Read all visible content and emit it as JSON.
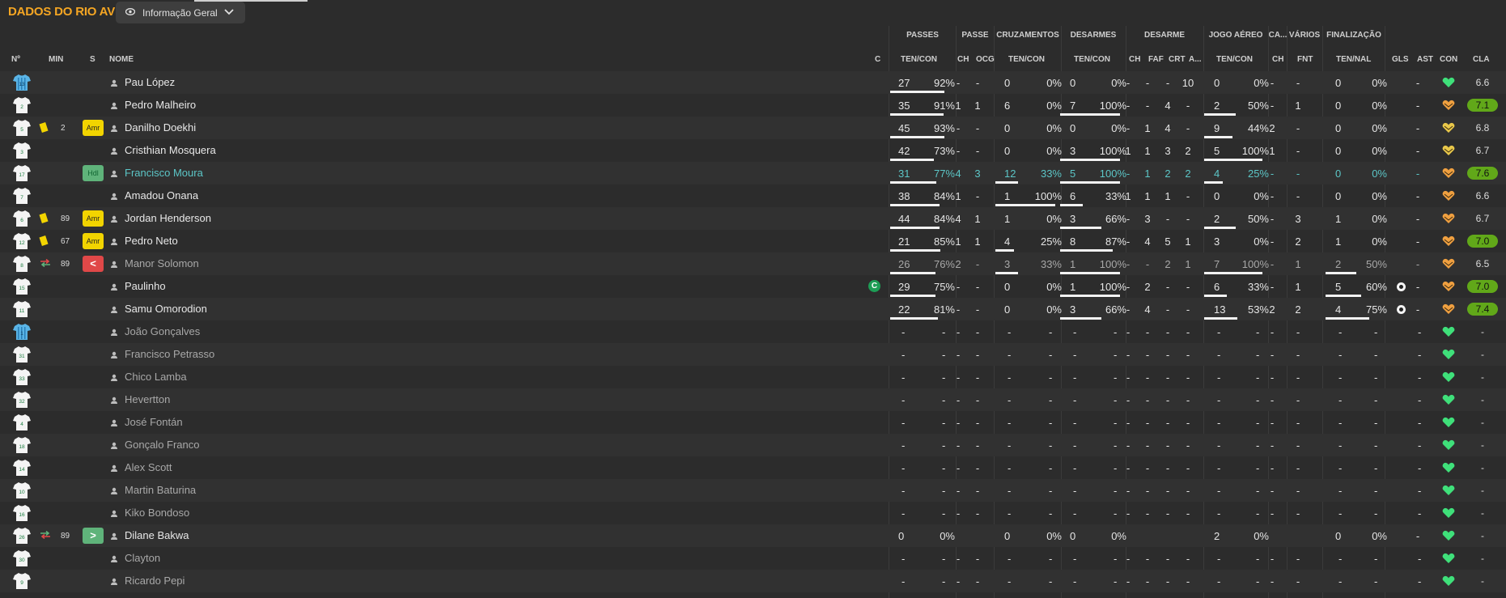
{
  "header": {
    "title": "DADOS DO RIO AVE",
    "view_dropdown": "Informação Geral"
  },
  "group_headers": {
    "passes": "PASSES",
    "passe": "PASSE",
    "cruzamentos": "CRUZAMENTOS",
    "desarmes": "DESARMES",
    "desarme": "DESARME",
    "jogo_aereo": "JOGO AÉREO",
    "ca": "CA...",
    "varios": "VÁRIOS",
    "finalizacao": "FINALIZAÇÃO"
  },
  "columns": {
    "num": "Nº",
    "min": "MIN",
    "s": "S",
    "nome": "NOME",
    "c": "C",
    "passes": "TEN/CON",
    "passe_ch": "CH",
    "passe_ocg": "OCG",
    "cruz": "TEN/CON",
    "desarmes": "TEN/CON",
    "des_ch": "CH",
    "des_faf": "FAF",
    "des_crt": "CRT",
    "des_a": "A...",
    "aereo": "TEN/CON",
    "ca_ch": "CH",
    "fnt": "FNT",
    "final": "TEN/NAL",
    "gls": "GLS",
    "ast": "AST",
    "con": "CON",
    "cla": "CLA"
  },
  "colors": {
    "accent": "#f5a623",
    "heart_green": "#3fe07a",
    "heart_orange": "#f0a040",
    "rating_green": "#61a819"
  },
  "players": [
    {
      "num": "13",
      "gk": true,
      "name": "Pau López",
      "minutes": "",
      "card": false,
      "badge": "",
      "swap": "",
      "dim": false,
      "teal": false,
      "captain": false,
      "pt": "27",
      "pp": "92%",
      "pp_v": 0.92,
      "pch": "-",
      "ocg": "-",
      "cr": "0",
      "crp": "0%",
      "cr_v": 0,
      "ds": "0",
      "dsp": "0%",
      "ds_v": 0,
      "dch": "-",
      "faf": "-",
      "crt": "-",
      "da": "10",
      "ae": "0",
      "aep": "0%",
      "ae_v": 0,
      "cach": "-",
      "fnt": "-",
      "fi": "0",
      "fip": "0%",
      "fi_v": 0,
      "gls": "",
      "ast": "-",
      "heart": "green",
      "cla": "6.6",
      "cla_hl": false
    },
    {
      "num": "2",
      "gk": false,
      "name": "Pedro Malheiro",
      "minutes": "",
      "card": false,
      "badge": "",
      "swap": "",
      "dim": false,
      "teal": false,
      "captain": false,
      "pt": "35",
      "pp": "91%",
      "pp_v": 0.91,
      "pch": "1",
      "ocg": "1",
      "cr": "6",
      "crp": "0%",
      "cr_v": 0,
      "ds": "7",
      "dsp": "100%",
      "ds_v": 1,
      "dch": "-",
      "faf": "-",
      "crt": "4",
      "da": "-",
      "ae": "2",
      "aep": "50%",
      "ae_v": 0.5,
      "cach": "-",
      "fnt": "1",
      "fi": "0",
      "fip": "0%",
      "fi_v": 0,
      "gls": "",
      "ast": "-",
      "heart": "orange",
      "cla": "7.1",
      "cla_hl": true
    },
    {
      "num": "5",
      "gk": false,
      "name": "Danilho Doekhi",
      "minutes": "2",
      "card": true,
      "badge": "Amr",
      "swap": "",
      "dim": false,
      "teal": false,
      "captain": false,
      "pt": "45",
      "pp": "93%",
      "pp_v": 0.93,
      "pch": "-",
      "ocg": "-",
      "cr": "0",
      "crp": "0%",
      "cr_v": 0,
      "ds": "0",
      "dsp": "0%",
      "ds_v": 0,
      "dch": "-",
      "faf": "1",
      "crt": "4",
      "da": "-",
      "ae": "9",
      "aep": "44%",
      "ae_v": 0.44,
      "cach": "2",
      "fnt": "-",
      "fi": "0",
      "fip": "0%",
      "fi_v": 0,
      "gls": "",
      "ast": "-",
      "heart": "yellow",
      "cla": "6.8",
      "cla_hl": false
    },
    {
      "num": "3",
      "gk": false,
      "name": "Cristhian Mosquera",
      "minutes": "",
      "card": false,
      "badge": "",
      "swap": "",
      "dim": false,
      "teal": false,
      "captain": false,
      "pt": "42",
      "pp": "73%",
      "pp_v": 0.73,
      "pch": "-",
      "ocg": "-",
      "cr": "0",
      "crp": "0%",
      "cr_v": 0,
      "ds": "3",
      "dsp": "100%",
      "ds_v": 1,
      "dch": "1",
      "faf": "1",
      "crt": "3",
      "da": "2",
      "ae": "5",
      "aep": "100%",
      "ae_v": 1,
      "cach": "1",
      "fnt": "-",
      "fi": "0",
      "fip": "0%",
      "fi_v": 0,
      "gls": "",
      "ast": "-",
      "heart": "yellow",
      "cla": "6.7",
      "cla_hl": false
    },
    {
      "num": "17",
      "gk": false,
      "name": "Francisco Moura",
      "minutes": "",
      "card": false,
      "badge": "Hdl",
      "swap": "",
      "dim": false,
      "teal": true,
      "captain": false,
      "pt": "31",
      "pp": "77%",
      "pp_v": 0.77,
      "pch": "4",
      "ocg": "3",
      "cr": "12",
      "crp": "33%",
      "cr_v": 0.33,
      "ds": "5",
      "dsp": "100%",
      "ds_v": 1,
      "dch": "-",
      "faf": "1",
      "crt": "2",
      "da": "2",
      "ae": "4",
      "aep": "25%",
      "ae_v": 0.25,
      "cach": "-",
      "fnt": "-",
      "fi": "0",
      "fip": "0%",
      "fi_v": 0,
      "gls": "",
      "ast": "-",
      "heart": "orange",
      "cla": "7.6",
      "cla_hl": true
    },
    {
      "num": "7",
      "gk": false,
      "name": "Amadou Onana",
      "minutes": "",
      "card": false,
      "badge": "",
      "swap": "",
      "dim": false,
      "teal": false,
      "captain": false,
      "pt": "38",
      "pp": "84%",
      "pp_v": 0.84,
      "pch": "1",
      "ocg": "-",
      "cr": "1",
      "crp": "100%",
      "cr_v": 1,
      "ds": "6",
      "dsp": "33%",
      "ds_v": 0.33,
      "dch": "1",
      "faf": "1",
      "crt": "1",
      "da": "-",
      "ae": "0",
      "aep": "0%",
      "ae_v": 0,
      "cach": "-",
      "fnt": "-",
      "fi": "0",
      "fip": "0%",
      "fi_v": 0,
      "gls": "",
      "ast": "-",
      "heart": "orange",
      "cla": "6.6",
      "cla_hl": false
    },
    {
      "num": "6",
      "gk": false,
      "name": "Jordan Henderson",
      "minutes": "89",
      "card": true,
      "badge": "Amr",
      "swap": "",
      "dim": false,
      "teal": false,
      "captain": false,
      "pt": "44",
      "pp": "84%",
      "pp_v": 0.84,
      "pch": "4",
      "ocg": "1",
      "cr": "1",
      "crp": "0%",
      "cr_v": 0,
      "ds": "3",
      "dsp": "66%",
      "ds_v": 0.66,
      "dch": "-",
      "faf": "3",
      "crt": "-",
      "da": "-",
      "ae": "2",
      "aep": "50%",
      "ae_v": 0.5,
      "cach": "-",
      "fnt": "3",
      "fi": "1",
      "fip": "0%",
      "fi_v": 0,
      "gls": "",
      "ast": "-",
      "heart": "orange",
      "cla": "6.7",
      "cla_hl": false
    },
    {
      "num": "12",
      "gk": false,
      "name": "Pedro Neto",
      "minutes": "67",
      "card": true,
      "badge": "Amr",
      "swap": "",
      "dim": false,
      "teal": false,
      "captain": false,
      "pt": "21",
      "pp": "85%",
      "pp_v": 0.85,
      "pch": "1",
      "ocg": "1",
      "cr": "4",
      "crp": "25%",
      "cr_v": 0.25,
      "ds": "8",
      "dsp": "87%",
      "ds_v": 0.87,
      "dch": "-",
      "faf": "4",
      "crt": "5",
      "da": "1",
      "ae": "3",
      "aep": "0%",
      "ae_v": 0,
      "cach": "-",
      "fnt": "2",
      "fi": "1",
      "fip": "0%",
      "fi_v": 0,
      "gls": "",
      "ast": "-",
      "heart": "orange",
      "cla": "7.0",
      "cla_hl": true
    },
    {
      "num": "8",
      "gk": false,
      "name": "Manor Solomon",
      "minutes": "89",
      "card": false,
      "badge": "<",
      "swap": "out",
      "dim": true,
      "teal": false,
      "captain": false,
      "pt": "26",
      "pp": "76%",
      "pp_v": 0.76,
      "pch": "2",
      "ocg": "-",
      "cr": "3",
      "crp": "33%",
      "cr_v": 0.33,
      "ds": "1",
      "dsp": "100%",
      "ds_v": 1,
      "dch": "-",
      "faf": "-",
      "crt": "2",
      "da": "1",
      "ae": "7",
      "aep": "100%",
      "ae_v": 1,
      "cach": "-",
      "fnt": "1",
      "fi": "2",
      "fip": "50%",
      "fi_v": 0.5,
      "gls": "",
      "ast": "-",
      "heart": "orange",
      "cla": "6.5",
      "cla_hl": false
    },
    {
      "num": "15",
      "gk": false,
      "name": "Paulinho",
      "minutes": "",
      "card": false,
      "badge": "",
      "swap": "",
      "dim": false,
      "teal": false,
      "captain": true,
      "pt": "29",
      "pp": "75%",
      "pp_v": 0.75,
      "pch": "-",
      "ocg": "-",
      "cr": "0",
      "crp": "0%",
      "cr_v": 0,
      "ds": "1",
      "dsp": "100%",
      "ds_v": 1,
      "dch": "-",
      "faf": "2",
      "crt": "-",
      "da": "-",
      "ae": "6",
      "aep": "33%",
      "ae_v": 0.33,
      "cach": "-",
      "fnt": "1",
      "fi": "5",
      "fip": "60%",
      "fi_v": 0.6,
      "gls": "ball",
      "ast": "-",
      "heart": "orange",
      "cla": "7.0",
      "cla_hl": true
    },
    {
      "num": "11",
      "gk": false,
      "name": "Samu Omorodion",
      "minutes": "",
      "card": false,
      "badge": "",
      "swap": "",
      "dim": false,
      "teal": false,
      "captain": false,
      "pt": "22",
      "pp": "81%",
      "pp_v": 0.81,
      "pch": "-",
      "ocg": "-",
      "cr": "0",
      "crp": "0%",
      "cr_v": 0,
      "ds": "3",
      "dsp": "66%",
      "ds_v": 0.66,
      "dch": "-",
      "faf": "4",
      "crt": "-",
      "da": "-",
      "ae": "13",
      "aep": "53%",
      "ae_v": 0.53,
      "cach": "2",
      "fnt": "2",
      "fi": "4",
      "fip": "75%",
      "fi_v": 0.75,
      "gls": "ball",
      "ast": "-",
      "heart": "orange",
      "cla": "7.4",
      "cla_hl": true
    },
    {
      "num": "1",
      "gk": true,
      "name": "João Gonçalves",
      "minutes": "",
      "card": false,
      "badge": "",
      "swap": "",
      "dim": true,
      "teal": false,
      "captain": false,
      "empty": true,
      "heart": "green",
      "cla": "-"
    },
    {
      "num": "31",
      "gk": false,
      "name": "Francisco Petrasso",
      "minutes": "",
      "card": false,
      "badge": "",
      "swap": "",
      "dim": true,
      "teal": false,
      "captain": false,
      "empty": true,
      "heart": "green",
      "cla": "-"
    },
    {
      "num": "33",
      "gk": false,
      "name": "Chico Lamba",
      "minutes": "",
      "card": false,
      "badge": "",
      "swap": "",
      "dim": true,
      "teal": false,
      "captain": false,
      "empty": true,
      "heart": "green",
      "cla": "-"
    },
    {
      "num": "32",
      "gk": false,
      "name": "Hevertton",
      "minutes": "",
      "card": false,
      "badge": "",
      "swap": "",
      "dim": true,
      "teal": false,
      "captain": false,
      "empty": true,
      "heart": "green",
      "cla": "-"
    },
    {
      "num": "4",
      "gk": false,
      "name": "José Fontán",
      "minutes": "",
      "card": false,
      "badge": "",
      "swap": "",
      "dim": true,
      "teal": false,
      "captain": false,
      "empty": true,
      "heart": "green",
      "cla": "-"
    },
    {
      "num": "18",
      "gk": false,
      "name": "Gonçalo Franco",
      "minutes": "",
      "card": false,
      "badge": "",
      "swap": "",
      "dim": true,
      "teal": false,
      "captain": false,
      "empty": true,
      "heart": "green",
      "cla": "-"
    },
    {
      "num": "14",
      "gk": false,
      "name": "Alex Scott",
      "minutes": "",
      "card": false,
      "badge": "",
      "swap": "",
      "dim": true,
      "teal": false,
      "captain": false,
      "empty": true,
      "heart": "green",
      "cla": "-"
    },
    {
      "num": "10",
      "gk": false,
      "name": "Martin Baturina",
      "minutes": "",
      "card": false,
      "badge": "",
      "swap": "",
      "dim": true,
      "teal": false,
      "captain": false,
      "empty": true,
      "heart": "green",
      "cla": "-"
    },
    {
      "num": "16",
      "gk": false,
      "name": "Kiko Bondoso",
      "minutes": "",
      "card": false,
      "badge": "",
      "swap": "",
      "dim": true,
      "teal": false,
      "captain": false,
      "empty": true,
      "heart": "green",
      "cla": "-"
    },
    {
      "num": "26",
      "gk": false,
      "name": "Dilane Bakwa",
      "minutes": "89",
      "card": false,
      "badge": ">",
      "swap": "in",
      "dim": false,
      "teal": false,
      "captain": false,
      "pt": "0",
      "pp": "0%",
      "pp_v": 0,
      "pch": "",
      "ocg": "",
      "cr": "0",
      "crp": "0%",
      "cr_v": 0,
      "ds": "0",
      "dsp": "0%",
      "ds_v": 0,
      "dch": "",
      "faf": "",
      "crt": "",
      "da": "",
      "ae": "2",
      "aep": "0%",
      "ae_v": 0,
      "cach": "",
      "fnt": "",
      "fi": "0",
      "fip": "0%",
      "fi_v": 0,
      "gls": "",
      "ast": "-",
      "heart": "green",
      "cla": "-",
      "cla_hl": false,
      "nobars": true
    },
    {
      "num": "30",
      "gk": false,
      "name": "Clayton",
      "minutes": "",
      "card": false,
      "badge": "",
      "swap": "",
      "dim": true,
      "teal": false,
      "captain": false,
      "empty": true,
      "heart": "green",
      "cla": "-"
    },
    {
      "num": "9",
      "gk": false,
      "name": "Ricardo Pepi",
      "minutes": "",
      "card": false,
      "badge": "",
      "swap": "",
      "dim": true,
      "teal": false,
      "captain": false,
      "empty": true,
      "heart": "green",
      "cla": "-"
    }
  ]
}
